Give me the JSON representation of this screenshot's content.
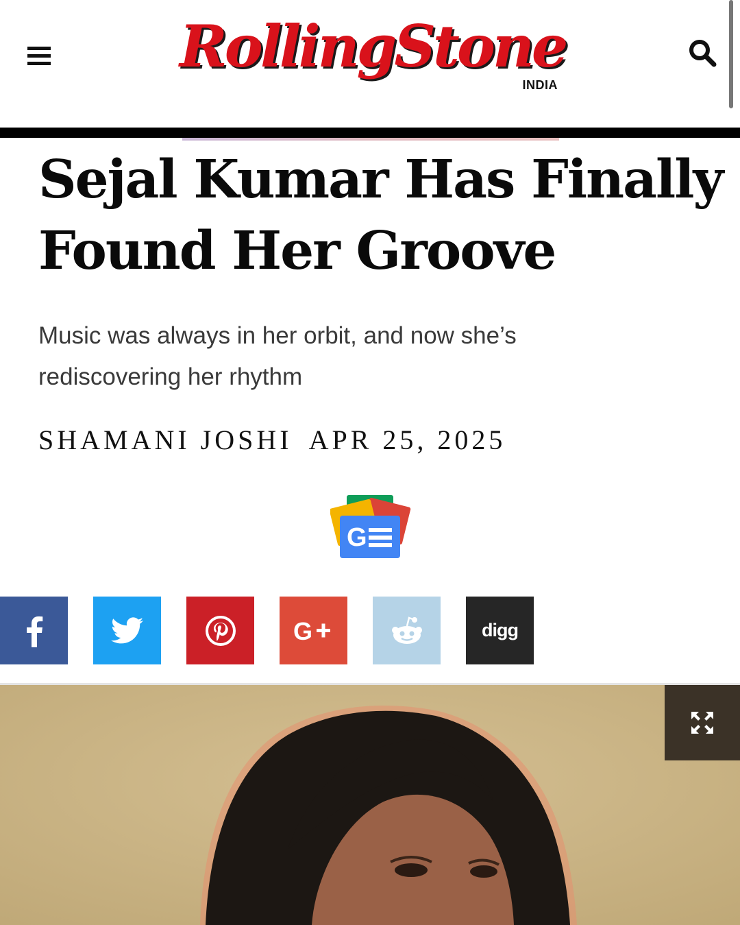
{
  "header": {
    "logo_text": "RollingStone",
    "logo_edition": "INDIA",
    "menu_icon": "hamburger-menu-icon",
    "search_icon": "search-icon"
  },
  "article": {
    "headline": "Sejal Kumar Has Finally Found Her Groove",
    "dek": "Music was always in her orbit, and now she’s rediscovering her rhythm",
    "author": "SHAMANI JOSHI",
    "date": "APR 25, 2025"
  },
  "google_news": {
    "icon": "google-news-icon",
    "colors": [
      "#0f9d58",
      "#f4b400",
      "#db4437",
      "#4285f4"
    ]
  },
  "share": [
    {
      "name": "facebook",
      "icon": "facebook-icon",
      "color": "#3b5998"
    },
    {
      "name": "twitter",
      "icon": "twitter-icon",
      "color": "#1da1f2"
    },
    {
      "name": "pinterest",
      "icon": "pinterest-icon",
      "color": "#cb2027"
    },
    {
      "name": "google-plus",
      "icon": "google-plus-icon",
      "label": "G+",
      "color": "#dd4b39"
    },
    {
      "name": "reddit",
      "icon": "reddit-icon",
      "color": "#b5d3e7"
    },
    {
      "name": "digg",
      "icon": "digg-icon",
      "label": "digg",
      "color": "#262626"
    }
  ],
  "hero": {
    "expand_icon": "expand-arrows-icon",
    "background": "#c9b487"
  }
}
